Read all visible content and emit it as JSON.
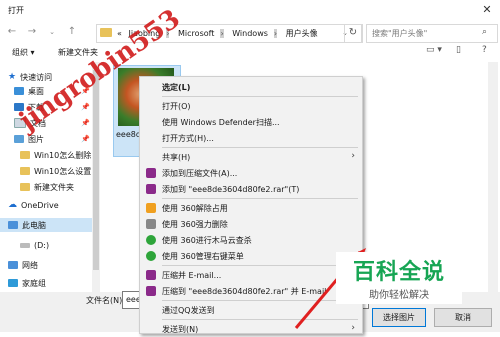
{
  "window": {
    "title": "打开",
    "close_icon": "close-icon"
  },
  "address": {
    "crumbs": [
      "«",
      "Jiaobing",
      "Microsoft",
      "Windows",
      "用户头像"
    ],
    "search_placeholder": "搜索\"用户头像\""
  },
  "toolbar": {
    "organize": "组织 ▾",
    "new_folder": "新建文件夹"
  },
  "sidebar": {
    "items": [
      {
        "label": "快速访问",
        "icon": "star-icon"
      },
      {
        "label": "桌面",
        "icon": "desktop-icon"
      },
      {
        "label": "下载",
        "icon": "download-icon"
      },
      {
        "label": "文档",
        "icon": "document-icon"
      },
      {
        "label": "图片",
        "icon": "picture-icon"
      },
      {
        "label": "Win10怎么删除",
        "icon": "folder-icon"
      },
      {
        "label": "Win10怎么设置",
        "icon": "folder-icon"
      },
      {
        "label": "新建文件夹",
        "icon": "folder-icon"
      },
      {
        "label": "OneDrive",
        "icon": "cloud-icon"
      },
      {
        "label": "此电脑",
        "icon": "computer-icon"
      },
      {
        "label": "(D:)",
        "icon": "drive-icon"
      },
      {
        "label": "网络",
        "icon": "network-icon"
      },
      {
        "label": "家庭组",
        "icon": "homegroup-icon"
      }
    ]
  },
  "file": {
    "label": "eee8de"
  },
  "footer": {
    "filename_label": "文件名(N):",
    "filename_value": "eee",
    "open_button": "选择图片",
    "cancel_button": "取消"
  },
  "context_menu": {
    "items": [
      {
        "label": "选定(L)",
        "bold": true
      },
      {
        "sep": true
      },
      {
        "label": "打开(O)"
      },
      {
        "label": "使用 Windows Defender扫描..."
      },
      {
        "label": "打开方式(H)..."
      },
      {
        "sep": true
      },
      {
        "label": "共享(H)",
        "submenu": true
      },
      {
        "label": "添加到压缩文件(A)...",
        "icon": "winrar-icon"
      },
      {
        "label": "添加到 \"eee8de3604d80fe2.rar\"(T)",
        "icon": "winrar-icon"
      },
      {
        "sep": true
      },
      {
        "label": "使用 360解除占用",
        "icon": "unlock-360-icon"
      },
      {
        "label": "使用 360强力删除",
        "icon": "delete-360-icon"
      },
      {
        "label": "使用 360进行木马云查杀",
        "icon": "scan-360-icon"
      },
      {
        "label": "使用 360管理右键菜单",
        "icon": "manage-360-icon"
      },
      {
        "sep": true
      },
      {
        "label": "压缩并 E-mail...",
        "icon": "winrar-icon"
      },
      {
        "label": "压缩到 \"eee8de3604d80fe2.rar\" 并 E-mail",
        "icon": "winrar-icon"
      },
      {
        "sep": true
      },
      {
        "label": "通过QQ发送到"
      },
      {
        "sep": true
      },
      {
        "label": "发送到(N)",
        "submenu": true
      }
    ]
  },
  "watermark": {
    "text": "jingrobin553"
  },
  "logo": {
    "main": "百科全说",
    "sub": "助你轻松解决"
  },
  "colors": {
    "selection": "#cce4f7",
    "winrar": "#8b2a8a",
    "green360": "#2ea53a",
    "logo": "#17a554",
    "watermark": "#d11b1b"
  }
}
